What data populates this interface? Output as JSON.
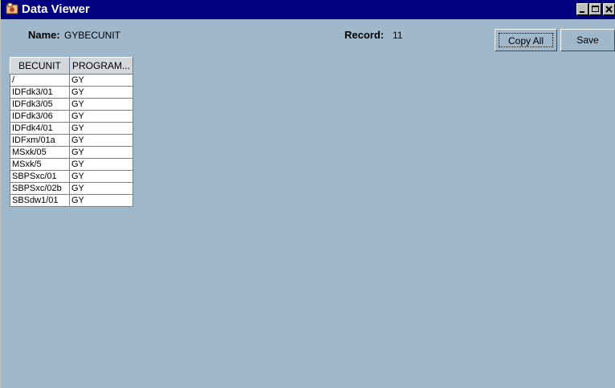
{
  "window": {
    "title": "Data Viewer",
    "app_icon": "data-viewer-app-icon",
    "colors": {
      "titlebar": "#000080",
      "background": "#9fb8cc"
    }
  },
  "header": {
    "name_label": "Name:",
    "name_value": "GYBECUNIT",
    "record_label": "Record:",
    "record_value": "11",
    "copy_all_label": "Copy All",
    "save_label": "Save"
  },
  "table": {
    "columns": [
      "BECUNIT",
      "PROGRAM..."
    ],
    "rows": [
      [
        "/",
        "GY"
      ],
      [
        "IDFdk3/01",
        "GY"
      ],
      [
        "IDFdk3/05",
        "GY"
      ],
      [
        "IDFdk3/06",
        "GY"
      ],
      [
        "IDFdk4/01",
        "GY"
      ],
      [
        "IDFxm/01a",
        "GY"
      ],
      [
        "MSxk/05",
        "GY"
      ],
      [
        "MSxk/5",
        "GY"
      ],
      [
        "SBPSxc/01",
        "GY"
      ],
      [
        "SBPSxc/02b",
        "GY"
      ],
      [
        "SBSdw1/01",
        "GY"
      ]
    ]
  }
}
